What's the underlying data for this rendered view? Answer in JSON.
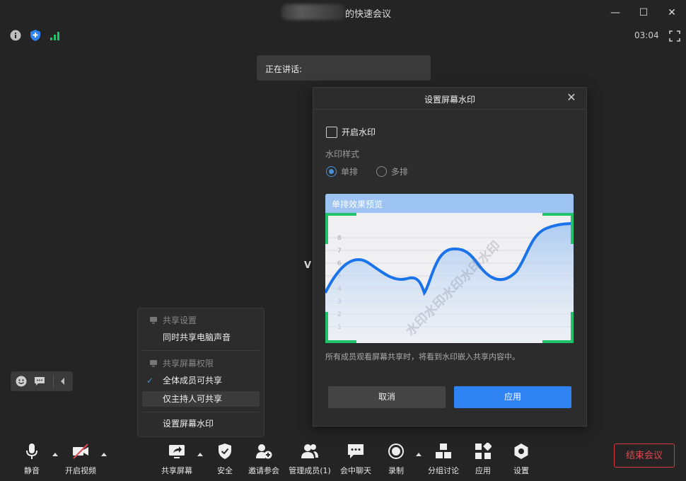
{
  "window": {
    "title": "的快速会议",
    "minimize": "—",
    "maximize": "☐",
    "close": "✕"
  },
  "status": {
    "timer": "03:04"
  },
  "speaking": {
    "label": "正在讲话:"
  },
  "video": {
    "participant_label": "V"
  },
  "dialog": {
    "title": "设置屏幕水印",
    "close": "✕",
    "enable_label": "开启水印",
    "style_label": "水印样式",
    "options": [
      "单排",
      "多排"
    ],
    "selected_option": "单排",
    "preview_title": "单排效果预览",
    "watermark_text": "水印水印水印水印水印",
    "preview_ticks": [
      "8",
      "7",
      "6",
      "5",
      "4",
      "3",
      "2",
      "1"
    ],
    "note": "所有成员观看屏幕共享时，将看到水印嵌入共享内容中。",
    "cancel": "取消",
    "apply": "应用"
  },
  "share_menu": {
    "section1": "共享设置",
    "item_audio": "同时共享电脑声音",
    "section2": "共享屏幕权限",
    "item_all": "全体成员可共享",
    "item_host": "仅主持人可共享",
    "item_watermark": "设置屏幕水印",
    "checked": "全体成员可共享"
  },
  "toolbar": {
    "mute": "静音",
    "video": "开启视频",
    "share": "共享屏幕",
    "security": "安全",
    "invite": "邀请参会",
    "manage": "管理成员(1)",
    "chat": "会中聊天",
    "record": "录制",
    "breakout": "分组讨论",
    "apps": "应用",
    "settings": "设置",
    "end": "结束会议"
  },
  "colors": {
    "accent": "#2f82f2",
    "end": "#d9363e",
    "corner": "#1fc36a"
  }
}
